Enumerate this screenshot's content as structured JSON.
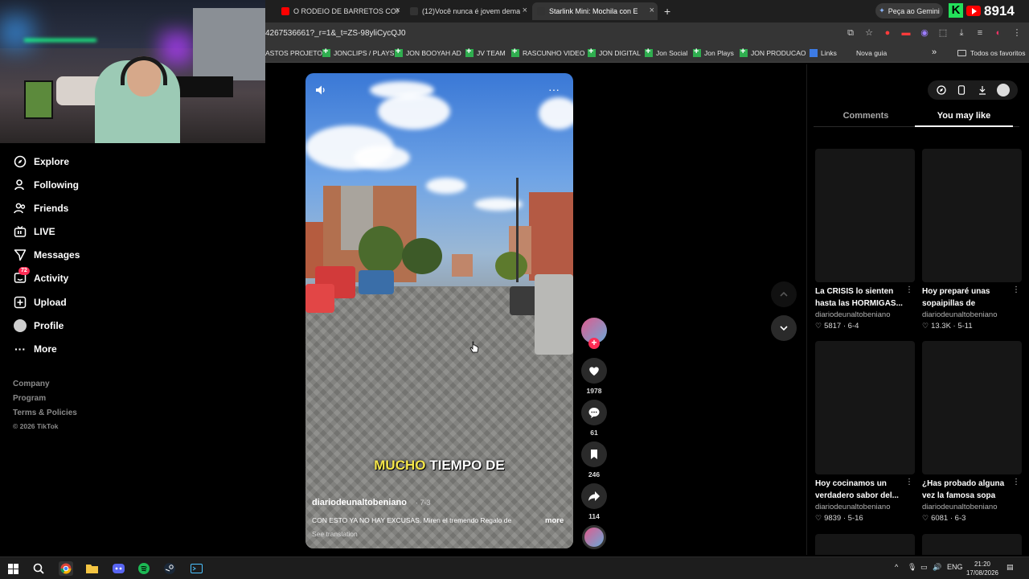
{
  "browser": {
    "tabs": [
      {
        "title": "O RODEIO DE BARRETOS COM",
        "favicon_color": "#ff0000"
      },
      {
        "title": "(12)Você nunca é jovem dema",
        "favicon_color": "#111111"
      },
      {
        "title": "Starlink Mini: Mochila con E",
        "favicon_color": "#111111"
      }
    ],
    "new_tab_label": "+",
    "gemini_label": "Peça ao Gemini",
    "url": "4267536661?_r=1&_t=ZS-98yliCycQJ0",
    "stream_badge": "K",
    "viewer_count": "8914",
    "bookmarks": [
      {
        "label": "ASTOS PROJETO",
        "icon": "none"
      },
      {
        "label": "JONCLIPS / PLAYS",
        "icon": "sheets"
      },
      {
        "label": "JON BOOYAH AD",
        "icon": "sheets"
      },
      {
        "label": "JV TEAM",
        "icon": "sheets"
      },
      {
        "label": "RASCUNHO VIDEO",
        "icon": "sheets"
      },
      {
        "label": "JON DIGITAL",
        "icon": "sheets"
      },
      {
        "label": "Jon Social",
        "icon": "sheets"
      },
      {
        "label": "Jon Plays",
        "icon": "sheets"
      },
      {
        "label": "JON PRODUCAO",
        "icon": "sheets"
      },
      {
        "label": "Links",
        "icon": "blue"
      },
      {
        "label": "Nova guia",
        "icon": "none"
      }
    ],
    "bookmarks_overflow": "»",
    "all_bookmarks": "Todos os favoritos"
  },
  "sidebar": {
    "items": [
      {
        "label": "Explore",
        "icon": "compass-icon"
      },
      {
        "label": "Following",
        "icon": "person-icon"
      },
      {
        "label": "Friends",
        "icon": "friends-icon"
      },
      {
        "label": "LIVE",
        "icon": "live-icon"
      },
      {
        "label": "Messages",
        "icon": "send-icon"
      },
      {
        "label": "Activity",
        "icon": "inbox-icon",
        "badge": "72"
      },
      {
        "label": "Upload",
        "icon": "plus-square-icon"
      },
      {
        "label": "Profile",
        "icon": "avatar"
      },
      {
        "label": "More",
        "icon": "more-icon"
      }
    ],
    "footer": [
      "Company",
      "Program",
      "Terms & Policies",
      "© 2026 TikTok"
    ]
  },
  "video": {
    "caption_highlight": "MUCHO",
    "caption_rest": " TIEMPO DE",
    "username": "diariodeunaltobeniano",
    "date": "· 7-3",
    "description": "CON ESTO YA NO HAY EXCUSAS. Miren el tremendo Regalo de",
    "more_label": "more",
    "see_translation": "See translation",
    "likes": "1978",
    "comments": "61",
    "saves": "246",
    "shares": "114"
  },
  "panel": {
    "tab_comments": "Comments",
    "tab_you_may_like": "You may like",
    "recommendations": [
      {
        "title": "La CRISIS lo sienten hasta las HORMIGAS...",
        "author": "diariodeunaltobeniano",
        "likes": "5817",
        "date": "· 6-4"
      },
      {
        "title": "Hoy preparé unas sopaipillas de banana...",
        "author": "diariodeunaltobeniano",
        "likes": "13.3K",
        "date": "· 5-11"
      },
      {
        "title": "Hoy cocinamos un verdadero sabor del...",
        "author": "diariodeunaltobeniano",
        "likes": "9839",
        "date": "· 5-16"
      },
      {
        "title": "¿Has probado alguna vez la famosa sopa de...",
        "author": "diariodeunaltobeniano",
        "likes": "6081",
        "date": "· 6-3"
      }
    ]
  },
  "taskbar": {
    "lang": "ENG",
    "time": "21:20",
    "date": "17/08/2026"
  },
  "colors": {
    "accent": "#fe2c55",
    "highlight_caption": "#f6e74a",
    "sheets_green": "#2fae4f"
  }
}
